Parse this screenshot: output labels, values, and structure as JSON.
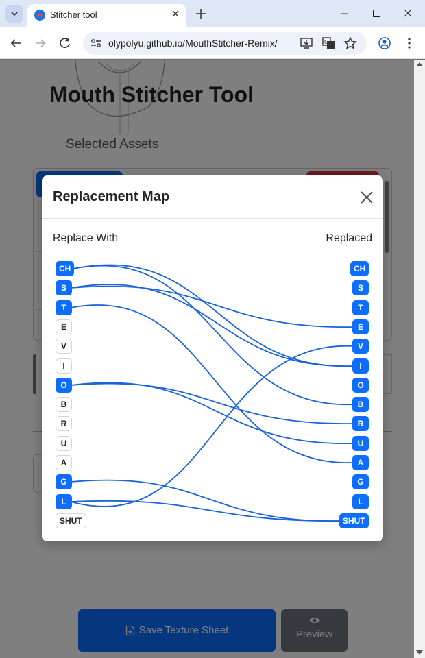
{
  "browser": {
    "tab_title": "Stitcher tool",
    "url": "olypolyu.github.io/MouthStitcher-Remix/"
  },
  "page": {
    "title": "Mouth Stitcher Tool",
    "assets_heading": "Selected Assets",
    "save_button": "Save Texture Sheet",
    "preview_button": "Preview"
  },
  "modal": {
    "title": "Replacement Map",
    "left_heading": "Replace With",
    "right_heading": "Replaced",
    "left_chips": [
      {
        "label": "CH",
        "active": true
      },
      {
        "label": "S",
        "active": true
      },
      {
        "label": "T",
        "active": true
      },
      {
        "label": "E",
        "active": false
      },
      {
        "label": "V",
        "active": false
      },
      {
        "label": "I",
        "active": false
      },
      {
        "label": "O",
        "active": true
      },
      {
        "label": "B",
        "active": false
      },
      {
        "label": "R",
        "active": false
      },
      {
        "label": "U",
        "active": false
      },
      {
        "label": "A",
        "active": false
      },
      {
        "label": "G",
        "active": true
      },
      {
        "label": "L",
        "active": true
      },
      {
        "label": "SHUT",
        "active": false
      }
    ],
    "right_chips": [
      "CH",
      "S",
      "T",
      "E",
      "V",
      "I",
      "O",
      "B",
      "R",
      "U",
      "A",
      "G",
      "L",
      "SHUT"
    ],
    "connections": [
      {
        "from": "CH",
        "to": "B"
      },
      {
        "from": "CH",
        "to": "I"
      },
      {
        "from": "S",
        "to": "E"
      },
      {
        "from": "S",
        "to": "I"
      },
      {
        "from": "T",
        "to": "A"
      },
      {
        "from": "O",
        "to": "R"
      },
      {
        "from": "O",
        "to": "U"
      },
      {
        "from": "L",
        "to": "V"
      },
      {
        "from": "L",
        "to": "SHUT"
      },
      {
        "from": "G",
        "to": "SHUT"
      }
    ],
    "line_color": "#1a63d8",
    "chip_color": "#0d6efd"
  }
}
